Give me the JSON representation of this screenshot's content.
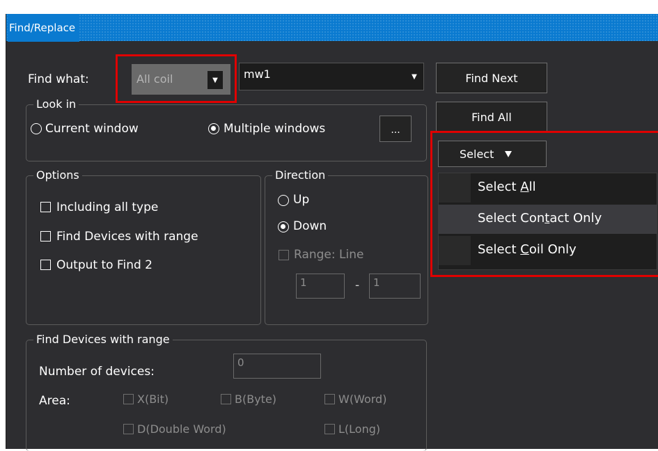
{
  "window": {
    "title": "Find/Replace"
  },
  "find": {
    "label": "Find what:",
    "type_combo": "All coil",
    "text_combo": "mw1"
  },
  "buttons": {
    "find_next": "Find Next",
    "find_all": "Find All",
    "select": "Select",
    "browse": "..."
  },
  "look_in": {
    "legend": "Look in",
    "current_window": "Current window",
    "multiple_windows": "Multiple windows",
    "selected": "multiple_windows"
  },
  "options": {
    "legend": "Options",
    "including_all_type": "Including all type",
    "find_devices_with_range": "Find Devices with range",
    "output_to_find2": "Output to Find 2"
  },
  "direction": {
    "legend": "Direction",
    "up": "Up",
    "down": "Down",
    "selected": "down",
    "range_line": "Range: Line",
    "range_from": "1",
    "range_sep": "-",
    "range_to": "1"
  },
  "range_group": {
    "legend": "Find Devices with range",
    "number_label": "Number of devices:",
    "number_value": "0",
    "area_label": "Area:",
    "x_bit": "X(Bit)",
    "b_byte": "B(Byte)",
    "w_word": "W(Word)",
    "d_double_word": "D(Double Word)",
    "l_long": "L(Long)"
  },
  "select_menu": {
    "items": [
      {
        "pre": "Select ",
        "key": "A",
        "post": "ll"
      },
      {
        "pre": "Select Con",
        "key": "t",
        "post": "act Only"
      },
      {
        "pre": "Select ",
        "key": "C",
        "post": "oil Only"
      }
    ],
    "highlighted_index": 1
  },
  "colors": {
    "titlebar": "#0a7ad0",
    "window_bg": "#2d2d30",
    "highlight_box": "#e00000",
    "menu_bg": "#1e1e1e",
    "menu_hover": "#3b3b3f"
  }
}
